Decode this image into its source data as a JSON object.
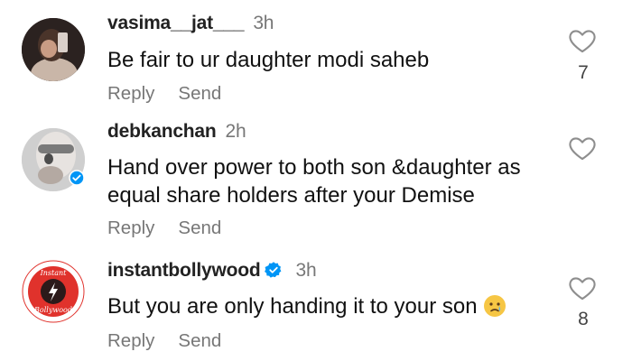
{
  "comments": [
    {
      "username": "vasima__jat___",
      "time": "3h",
      "text": "Be fair to ur daughter modi saheb",
      "reply_label": "Reply",
      "send_label": "Send",
      "likes": "7"
    },
    {
      "username": "debkanchan",
      "time": "2h",
      "text_line1": "Hand over power to both son &daughter as",
      "text_line2": "equal share holders after your Demise",
      "reply_label": "Reply",
      "send_label": "Send"
    },
    {
      "username": "instantbollywood",
      "time": "3h",
      "text": "But you are only handing it to your son",
      "reply_label": "Reply",
      "send_label": "Send",
      "likes": "8",
      "avatar_logo_text": "Instant Bollywood"
    }
  ],
  "colors": {
    "verified": "#0095f6",
    "brand_red": "#e0322c",
    "muted": "#777777"
  },
  "icons": [
    "heart-outline-icon",
    "verified-badge-icon",
    "crying-face-emoji"
  ]
}
